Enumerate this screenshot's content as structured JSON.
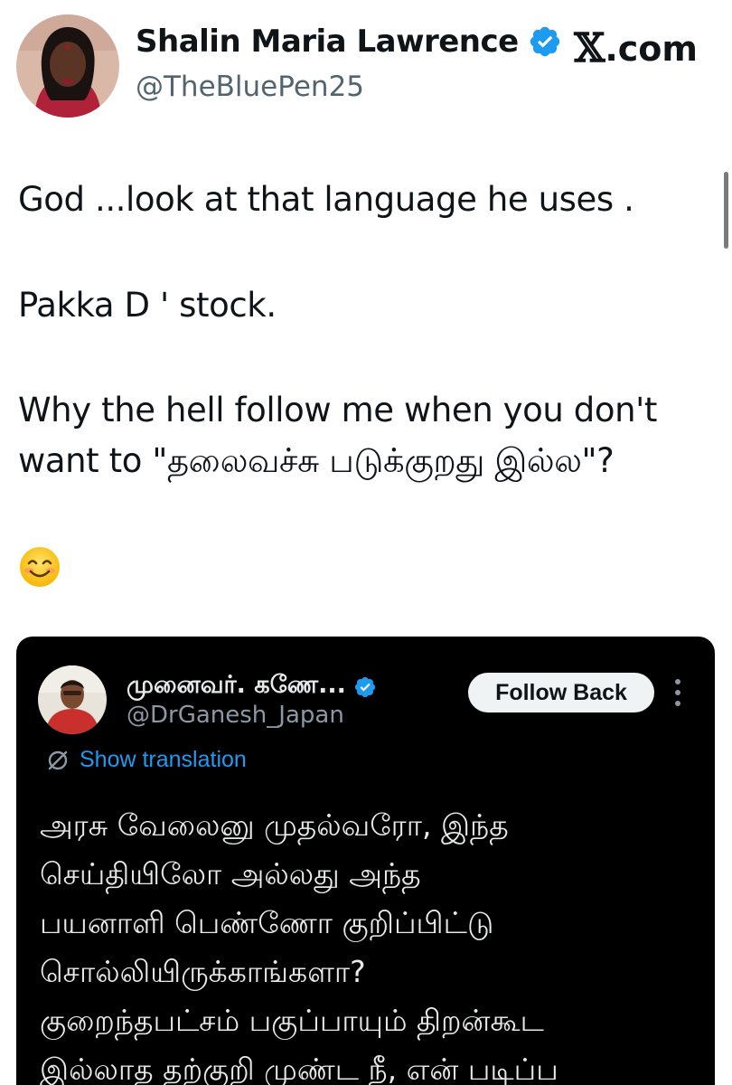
{
  "tweet": {
    "display_name": "Shalin Maria Lawrence",
    "handle": "@TheBluePen25",
    "brand": "X.com",
    "brand_mark": "𝕏",
    "brand_suffix": ".com",
    "text_lines": [
      "God ...look at that language he uses .",
      "Pakka D ' stock.",
      "Why the hell follow me when you don't want to \"தலைவச்சு படுக்குறது இல்ல\"?"
    ],
    "emoji": "smiling-face-emoji"
  },
  "quoted": {
    "display_name": "முனைவர். கணே...",
    "handle": "@DrGanesh_Japan",
    "follow_button_label": "Follow Back",
    "show_translation_label": "Show translation",
    "text": "அரசு வேலைனு முதல்வரோ, இந்த\nசெய்தியிலோ அல்லது அந்த\nபயனாளி பெண்ணோ குறிப்பிட்டு\nசொல்லியிருக்காங்களா?\nகுறைந்தபட்சம் பகுப்பாயும் திறன்கூட\nஇல்லாத தற்குறி முண்ட நீ, என் படிப்ப"
  },
  "colors": {
    "verified_blue": "#1d9bf0",
    "link_blue": "#1d9bf0",
    "text_primary": "#0f1419",
    "text_secondary": "#536471",
    "card_bg": "#000000"
  },
  "icons": [
    "verified-badge-icon",
    "more-options-icon",
    "translate-icon",
    "smiling-face-emoji"
  ]
}
